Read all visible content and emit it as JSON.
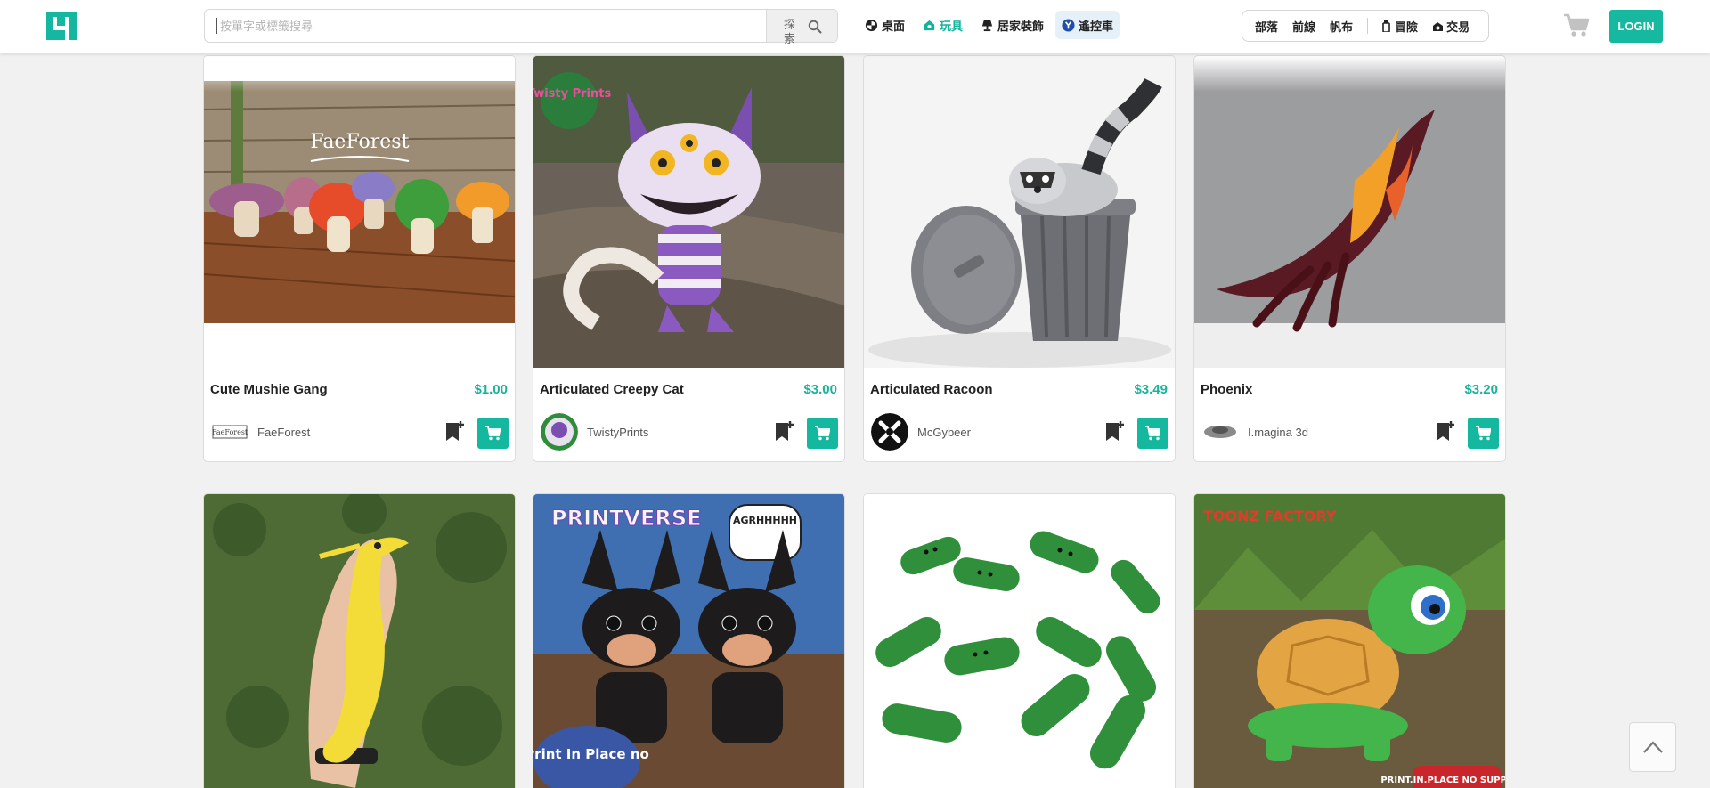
{
  "header": {
    "logo_icon": "cults-logo-icon",
    "search": {
      "placeholder": "按單字或標籤搜尋",
      "button_label": "探索",
      "icon": "search-icon"
    },
    "categories": [
      {
        "label": "桌面",
        "icon": "swirl-icon"
      },
      {
        "label": "玩具",
        "icon": "toy-icon",
        "active": true
      },
      {
        "label": "居家裝飾",
        "icon": "lamp-icon"
      },
      {
        "label": "遙控車",
        "icon": "rc-car-icon",
        "highlight": true
      }
    ],
    "nav": [
      {
        "label": "部落"
      },
      {
        "label": "前線"
      },
      {
        "label": "帆布"
      },
      {
        "label": "冒險",
        "icon": "bottle-icon"
      },
      {
        "label": "交易",
        "icon": "trade-icon"
      }
    ],
    "cart_icon": "shopping-cart-icon",
    "login_label": "LOGIN"
  },
  "products": [
    {
      "title": "Cute Mushie Gang",
      "price": "$1.00",
      "creator": "FaeForest",
      "image_text": "FaeForest"
    },
    {
      "title": "Articulated Creepy Cat",
      "price": "$3.00",
      "creator": "TwistyPrints",
      "image_text": "Twisty Prints"
    },
    {
      "title": "Articulated Racoon",
      "price": "$3.49",
      "creator": "McGybeer"
    },
    {
      "title": "Phoenix",
      "price": "$3.20",
      "creator": "I.magina 3d"
    },
    {
      "title": "",
      "price": "",
      "creator": ""
    },
    {
      "title": "",
      "price": "",
      "creator": "",
      "image_text": "PRINTVERSE",
      "bubble_text": "AGRHHHHH",
      "badge_text": "Print In Place no"
    },
    {
      "title": "",
      "price": "",
      "creator": ""
    },
    {
      "title": "",
      "price": "",
      "creator": "",
      "image_text": "TOONZ FACTORY",
      "badge_text": "PRINT.IN.PLACE NO SUPPORTS"
    }
  ],
  "colors": {
    "accent": "#17b8a0",
    "price": "#19b39b",
    "background": "#f1f1f1"
  },
  "scroll_top_icon": "chevron-up-icon"
}
